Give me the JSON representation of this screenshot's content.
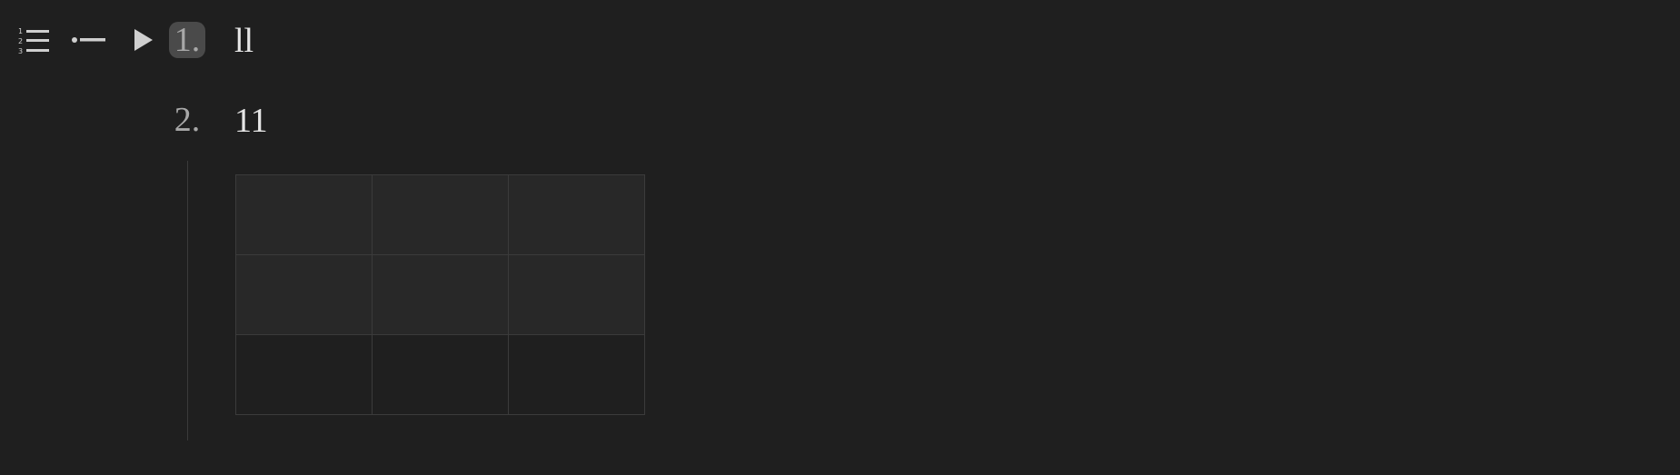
{
  "toolbar": {
    "buttons": [
      {
        "icon": "numbered-list-icon"
      },
      {
        "icon": "bullet-list-icon"
      },
      {
        "icon": "play-icon"
      }
    ]
  },
  "list": {
    "items": [
      {
        "marker": "1.",
        "text": "ll",
        "active": true
      },
      {
        "marker": "2.",
        "text": "11",
        "active": false
      }
    ]
  },
  "table": {
    "rows": [
      {
        "type": "header",
        "cells": [
          "",
          "",
          ""
        ]
      },
      {
        "type": "header",
        "cells": [
          "",
          "",
          ""
        ]
      },
      {
        "type": "body",
        "cells": [
          "",
          "",
          ""
        ]
      }
    ]
  },
  "colors": {
    "background": "#1f1f1f",
    "active_marker_bg": "#4a4a4a",
    "header_cell_bg": "#282828",
    "grid_line": "#3b3b3b"
  }
}
